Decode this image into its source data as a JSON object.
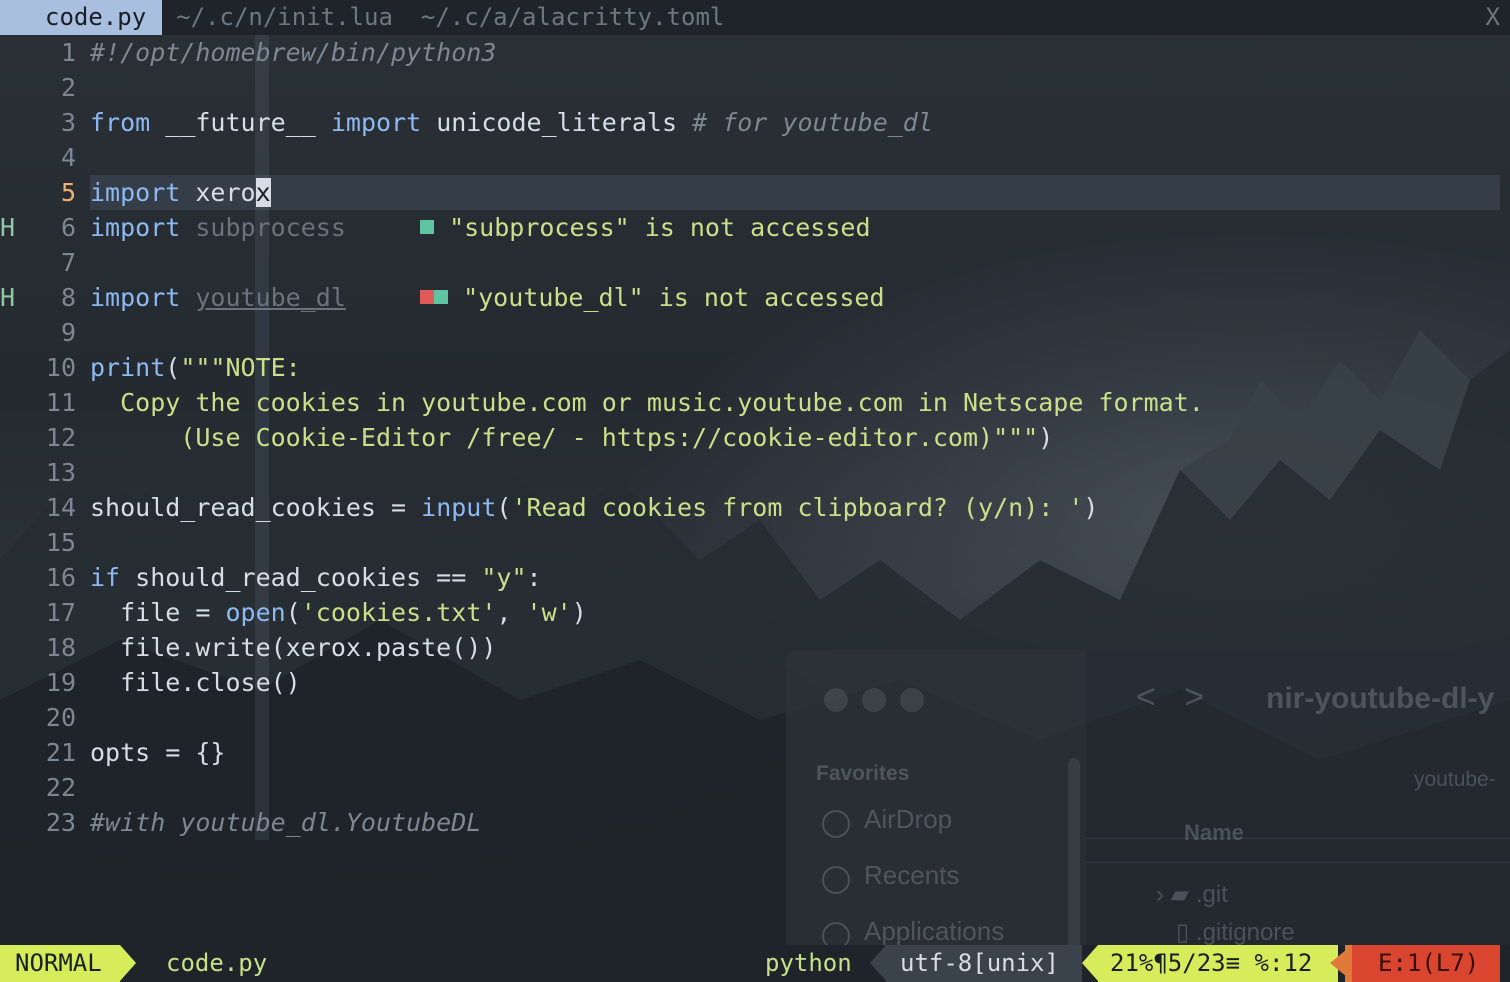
{
  "colors": {
    "accent_tab": "#a8bfe0",
    "mode_bg": "#d7ec5a",
    "error_bg": "#d9452e",
    "keyword": "#8db8f2",
    "string": "#c8e08a",
    "comment": "#7d8894",
    "current_line_number": "#f0b070"
  },
  "tabs": [
    {
      "label": "code.py",
      "active": true
    },
    {
      "label": "~/.c/n/init.lua",
      "active": false
    },
    {
      "label": "~/.c/a/alacritty.toml",
      "active": false
    }
  ],
  "tab_close_label": "X",
  "editor": {
    "lines": [
      {
        "n": "1",
        "sign": "",
        "tokens": [
          {
            "t": "#!/opt/homebrew/bin/python3",
            "c": "cm"
          }
        ]
      },
      {
        "n": "2",
        "sign": "",
        "tokens": []
      },
      {
        "n": "3",
        "sign": "",
        "tokens": [
          {
            "t": "from",
            "c": "kw"
          },
          {
            "t": " __future__ "
          },
          {
            "t": "import",
            "c": "kw"
          },
          {
            "t": " unicode_literals "
          },
          {
            "t": "# for youtube_dl",
            "c": "cm"
          }
        ]
      },
      {
        "n": "4",
        "sign": "",
        "tokens": []
      },
      {
        "n": "5",
        "sign": "",
        "current": true,
        "tokens": [
          {
            "t": "import",
            "c": "kw"
          },
          {
            "t": " xero"
          },
          {
            "t": "x",
            "c": "cur-cell"
          }
        ]
      },
      {
        "n": "6",
        "sign": "H",
        "tokens": [
          {
            "t": "import",
            "c": "kw"
          },
          {
            "t": " "
          },
          {
            "t": "subprocess",
            "c": "unused"
          }
        ],
        "diagnostic": {
          "markers": [
            "green"
          ],
          "text": "\"subprocess\" is not accessed"
        }
      },
      {
        "n": "7",
        "sign": "",
        "tokens": []
      },
      {
        "n": "8",
        "sign": "H",
        "tokens": [
          {
            "t": "import",
            "c": "kw"
          },
          {
            "t": " "
          },
          {
            "t": "youtube_dl",
            "c": "unused-ul"
          }
        ],
        "diagnostic": {
          "markers": [
            "red",
            "green"
          ],
          "text": "\"youtube_dl\" is not accessed"
        }
      },
      {
        "n": "9",
        "sign": "",
        "tokens": []
      },
      {
        "n": "10",
        "sign": "",
        "tokens": [
          {
            "t": "print",
            "c": "fn"
          },
          {
            "t": "("
          },
          {
            "t": "\"\"\"NOTE:",
            "c": "str"
          }
        ]
      },
      {
        "n": "11",
        "sign": "",
        "tokens": [
          {
            "t": "  Copy the cookies in youtube.com or music.youtube.com in Netscape format.",
            "c": "str"
          }
        ]
      },
      {
        "n": "12",
        "sign": "",
        "tokens": [
          {
            "t": "      (Use Cookie-Editor /free/ - https://cookie-editor.com)\"\"\"",
            "c": "str"
          },
          {
            "t": ")"
          }
        ]
      },
      {
        "n": "13",
        "sign": "",
        "tokens": []
      },
      {
        "n": "14",
        "sign": "",
        "tokens": [
          {
            "t": "should_read_cookies = "
          },
          {
            "t": "input",
            "c": "fn"
          },
          {
            "t": "("
          },
          {
            "t": "'Read cookies from clipboard? (y/n): '",
            "c": "str"
          },
          {
            "t": ")"
          }
        ]
      },
      {
        "n": "15",
        "sign": "",
        "tokens": []
      },
      {
        "n": "16",
        "sign": "",
        "tokens": [
          {
            "t": "if",
            "c": "kw"
          },
          {
            "t": " should_read_cookies == "
          },
          {
            "t": "\"y\"",
            "c": "str"
          },
          {
            "t": ":"
          }
        ]
      },
      {
        "n": "17",
        "sign": "",
        "tokens": [
          {
            "t": "  file = "
          },
          {
            "t": "open",
            "c": "fn"
          },
          {
            "t": "("
          },
          {
            "t": "'cookies.txt'",
            "c": "str"
          },
          {
            "t": ", "
          },
          {
            "t": "'w'",
            "c": "str"
          },
          {
            "t": ")"
          }
        ]
      },
      {
        "n": "18",
        "sign": "",
        "tokens": [
          {
            "t": "  file.write(xerox.paste())"
          }
        ]
      },
      {
        "n": "19",
        "sign": "",
        "tokens": [
          {
            "t": "  file.close()"
          }
        ]
      },
      {
        "n": "20",
        "sign": "",
        "tokens": []
      },
      {
        "n": "21",
        "sign": "",
        "tokens": [
          {
            "t": "opts = {}"
          }
        ]
      },
      {
        "n": "22",
        "sign": "",
        "tokens": []
      },
      {
        "n": "23",
        "sign": "",
        "tokens": [
          {
            "t": "#with youtube_dl.YoutubeDL",
            "c": "cm"
          }
        ]
      }
    ]
  },
  "statusline": {
    "mode": "NORMAL",
    "filename": "code.py",
    "filetype": "python",
    "encoding": "utf-8[unix]",
    "position": "21%¶5/23≡ %:12",
    "errors": "E:1(L7)"
  },
  "background_window": {
    "title": "nir-youtube-dl-y",
    "breadcrumb": "youtube-",
    "favorites_label": "Favorites",
    "sidebar_items": [
      "AirDrop",
      "Recents",
      "Applications"
    ],
    "column_header": "Name",
    "files": [
      ".git",
      ".gitignore"
    ]
  }
}
